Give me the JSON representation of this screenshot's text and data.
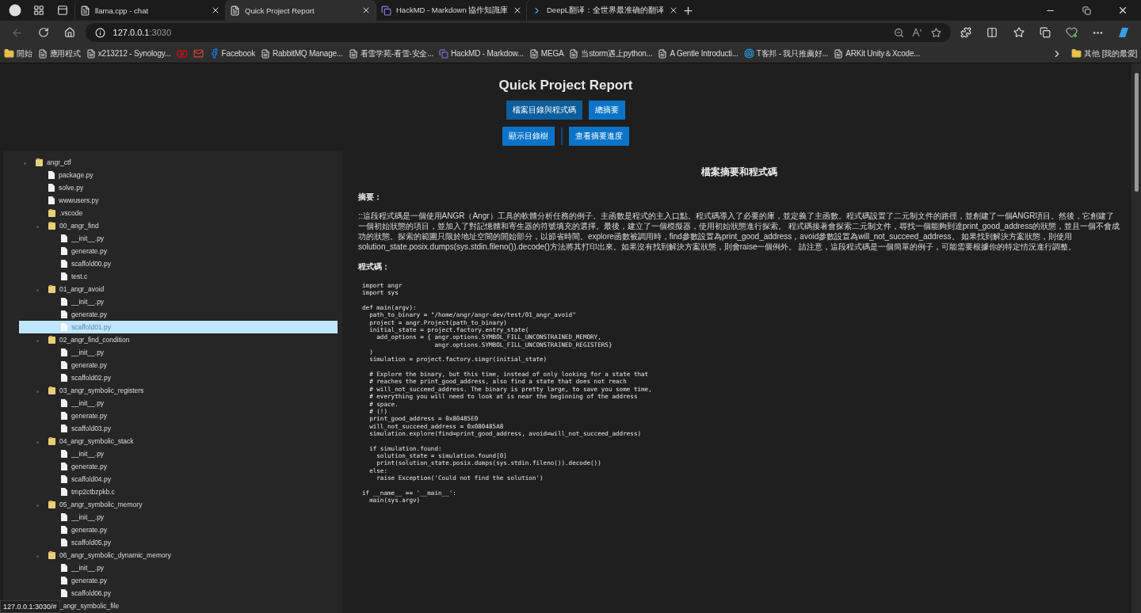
{
  "browser": {
    "tabs": [
      {
        "title": "llama.cpp - chat",
        "kind": "page",
        "selected": false
      },
      {
        "title": "Quick Project Report",
        "kind": "page",
        "selected": true
      },
      {
        "title": "HackMD - Markdown 協作知識庫",
        "kind": "hackmd",
        "selected": false
      },
      {
        "title": "DeepL翻译：全世界最准确的翻译",
        "kind": "deepl",
        "selected": false
      }
    ],
    "address": {
      "host": "127.0.0.1",
      "port": ":3030"
    },
    "bookmarks": [
      {
        "label": "開始",
        "kind": "folder"
      },
      {
        "label": "應用程式",
        "kind": "page"
      },
      {
        "label": "x213212 - Synology...",
        "kind": "page"
      },
      {
        "kind": "video"
      },
      {
        "kind": "mail"
      },
      {
        "label": "Facebook",
        "kind": "social"
      },
      {
        "label": "RabbitMQ Manage...",
        "kind": "page"
      },
      {
        "label": "看雪学苑-看雪-安全...",
        "kind": "page"
      },
      {
        "label": "HackMD - Markdow...",
        "kind": "hackmd"
      },
      {
        "label": "MEGA",
        "kind": "page"
      },
      {
        "label": "当storm遇上python...",
        "kind": "page"
      },
      {
        "label": "A Gentle Introducti...",
        "kind": "page"
      },
      {
        "label": "T客邦 - 我只推薦好...",
        "kind": "target"
      },
      {
        "label": "ARKit Unity＆Xcode...",
        "kind": "page"
      }
    ],
    "other_bookmarks": "其他 [我的最愛]",
    "status_url": "127.0.0.1:3030/#"
  },
  "page": {
    "title": "Quick Project Report",
    "buttons": [
      [
        {
          "label": "檔案目錄與程式碼",
          "selected": true
        },
        {
          "label": "總摘要",
          "selected": false
        }
      ],
      [
        {
          "label": "顯示目錄樹",
          "selected": false
        },
        {
          "label": "查看摘要進度",
          "selected": false
        }
      ]
    ],
    "tree": [
      {
        "name": "angr_ctf",
        "kind": "folder",
        "selected": false,
        "children": [
          {
            "name": "package.py",
            "kind": "file",
            "selected": false
          },
          {
            "name": "solve.py",
            "kind": "file",
            "selected": false
          },
          {
            "name": "wwwusers.py",
            "kind": "file",
            "selected": false
          },
          {
            "name": ".vscode",
            "kind": "folder",
            "selected": false
          },
          {
            "name": "00_angr_find",
            "kind": "folder",
            "selected": false,
            "children": [
              {
                "name": "__init__.py",
                "kind": "file",
                "selected": false
              },
              {
                "name": "generate.py",
                "kind": "file",
                "selected": false
              },
              {
                "name": "scaffold00.py",
                "kind": "file",
                "selected": false
              },
              {
                "name": "test.c",
                "kind": "file",
                "selected": false
              }
            ]
          },
          {
            "name": "01_angr_avoid",
            "kind": "folder",
            "selected": false,
            "children": [
              {
                "name": "__init__.py",
                "kind": "file",
                "selected": false
              },
              {
                "name": "generate.py",
                "kind": "file",
                "selected": false
              },
              {
                "name": "scaffold01.py",
                "kind": "file",
                "selected": true
              }
            ]
          },
          {
            "name": "02_angr_find_condition",
            "kind": "folder",
            "selected": false,
            "children": [
              {
                "name": "__init__.py",
                "kind": "file",
                "selected": false
              },
              {
                "name": "generate.py",
                "kind": "file",
                "selected": false
              },
              {
                "name": "scaffold02.py",
                "kind": "file",
                "selected": false
              }
            ]
          },
          {
            "name": "03_angr_symbolic_registers",
            "kind": "folder",
            "selected": false,
            "children": [
              {
                "name": "__init__.py",
                "kind": "file",
                "selected": false
              },
              {
                "name": "generate.py",
                "kind": "file",
                "selected": false
              },
              {
                "name": "scaffold03.py",
                "kind": "file",
                "selected": false
              }
            ]
          },
          {
            "name": "04_angr_symbolic_stack",
            "kind": "folder",
            "selected": false,
            "children": [
              {
                "name": "__init__.py",
                "kind": "file",
                "selected": false
              },
              {
                "name": "generate.py",
                "kind": "file",
                "selected": false
              },
              {
                "name": "scaffold04.py",
                "kind": "file",
                "selected": false
              },
              {
                "name": "tmp2ctbzpkb.c",
                "kind": "file",
                "selected": false
              }
            ]
          },
          {
            "name": "05_angr_symbolic_memory",
            "kind": "folder",
            "selected": false,
            "children": [
              {
                "name": "__init__.py",
                "kind": "file",
                "selected": false
              },
              {
                "name": "generate.py",
                "kind": "file",
                "selected": false
              },
              {
                "name": "scaffold05.py",
                "kind": "file",
                "selected": false
              }
            ]
          },
          {
            "name": "06_angr_symbolic_dynamic_memory",
            "kind": "folder",
            "selected": false,
            "children": [
              {
                "name": "__init__.py",
                "kind": "file",
                "selected": false
              },
              {
                "name": "generate.py",
                "kind": "file",
                "selected": false
              },
              {
                "name": "scaffold06.py",
                "kind": "file",
                "selected": false
              }
            ]
          },
          {
            "name": "_angr_symbolic_file",
            "selected": false
          }
        ]
      }
    ],
    "content": {
      "heading": "檔案摘要和程式碼",
      "summary_label": "摘要：",
      "summary": "::這段程式碼是一個使用ANGR（Angr）工具的軟體分析任務的例子。主函數是程式的主入口點。程式碼導入了必要的庫，並定義了主函數。程式碼設置了二元制文件的路徑，並創建了一個ANGR項目。然後，它創建了一個初始狀態的項目，並加入了對記憶體和寄生器的符號填充的選擇。最後，建立了一個模擬器，使用初始狀態進行探索。 程式碼接著會探索二元制文件，尋找一個能夠到達print_good_address的狀態，並且一個不會成功的狀態。探索的範圍只限於地址空間的開始部分，以節省時間。explore函數被調用時，find參數設置為print_good_address，avoid參數設置為will_not_succeed_address。 如果找到解決方案狀態，則使用solution_state.posix.dumps(sys.stdin.fileno()).decode()方法將其打印出來。如果沒有找到解決方案狀態，則會raise一個例外。 請注意，這段程式碼是一個簡單的例子，可能需要根據你的特定情況進行調整。",
      "code_label": "程式碼：",
      "code": "import angr\nimport sys\n\ndef main(argv):\n  path_to_binary = \"/home/angr/angr-dev/test/01_angr_avoid\"\n  project = angr.Project(path_to_binary)\n  initial_state = project.factory.entry_state(\n    add_options = { angr.options.SYMBOL_FILL_UNCONSTRAINED_MEMORY,\n                    angr.options.SYMBOL_FILL_UNCONSTRAINED_REGISTERS}\n  )\n  simulation = project.factory.simgr(initial_state)\n\n  # Explore the binary, but this time, instead of only looking for a state that\n  # reaches the print_good_address, also find a state that does not reach\n  # will_not_succeed_address. The binary is pretty large, to save you some time,\n  # everything you will need to look at is near the beginning of the address\n  # space.\n  # (!)\n  print_good_address = 0x80485E0\n  will_not_succeed_address = 0x080485A8\n  simulation.explore(find=print_good_address, avoid=will_not_succeed_address)\n\n  if simulation.found:\n    solution_state = simulation.found[0]\n    print(solution_state.posix.dumps(sys.stdin.fileno()).decode())\n  else:\n    raise Exception('Could not find the solution')\n\nif __name__ == '__main__':\n  main(sys.argv)"
    }
  }
}
